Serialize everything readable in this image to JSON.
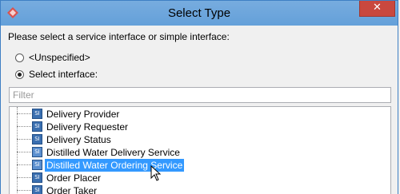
{
  "window": {
    "title": "Select Type",
    "close_glyph": "✕",
    "accent": "#6da6dd",
    "close_color": "#c9483e"
  },
  "prompt": "Please select a service interface or simple interface:",
  "radios": {
    "unspecified": {
      "label": "<Unspecified>",
      "checked": false
    },
    "select_interface": {
      "label": "Select interface:",
      "checked": true
    }
  },
  "filter": {
    "placeholder": "Filter",
    "value": ""
  },
  "tree": {
    "items": [
      {
        "label": "Delivery Provider",
        "icon": "service-interface-icon",
        "icon_text": "SI",
        "selected": false
      },
      {
        "label": "Delivery Requester",
        "icon": "service-interface-icon",
        "icon_text": "SI",
        "selected": false
      },
      {
        "label": "Delivery Status",
        "icon": "service-interface-icon",
        "icon_text": "SI",
        "selected": false
      },
      {
        "label": "Distilled Water Delivery Service",
        "icon": "simple-interface-icon",
        "icon_text": "SI",
        "selected": false
      },
      {
        "label": "Distilled Water Ordering Service",
        "icon": "simple-interface-icon",
        "icon_text": "SI",
        "selected": true
      },
      {
        "label": "Order Placer",
        "icon": "service-interface-icon",
        "icon_text": "SI",
        "selected": false
      },
      {
        "label": "Order Taker",
        "icon": "service-interface-icon",
        "icon_text": "SI",
        "selected": false
      }
    ],
    "selection_color": "#3399ff"
  }
}
